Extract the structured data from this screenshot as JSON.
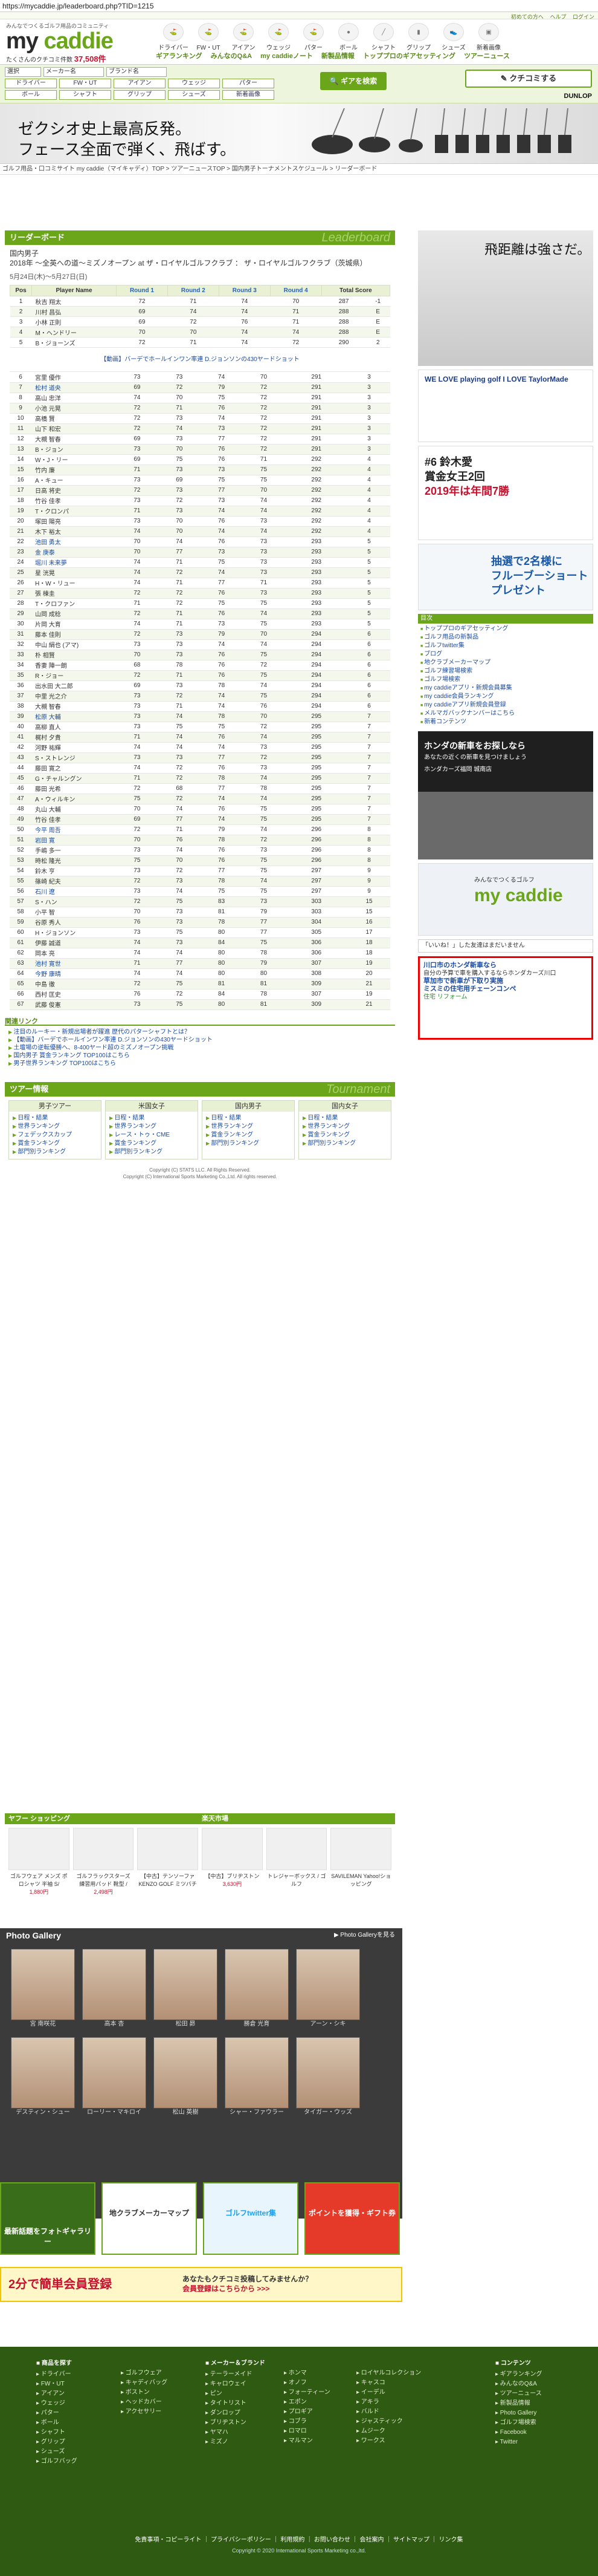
{
  "url": "https://mycaddie.jp/leaderboard.php?TID=1215",
  "top_links": [
    "初めての方へ",
    "ヘルプ",
    "ログイン"
  ],
  "logo": {
    "sub": "みんなでつくるゴルフ用品のコミュニティ",
    "name_a": "my ",
    "name_b": "caddie",
    "stat_label": "たくさんのクチコミ件数",
    "stat_value": "37,508件"
  },
  "category_nav": [
    "ドライバー",
    "FW・UT",
    "アイアン",
    "ウェッジ",
    "パター",
    "ボール",
    "シャフト",
    "グリップ",
    "シューズ",
    "新着画像"
  ],
  "sub_nav": [
    "ギアランキング",
    "みんなのQ&A",
    "my caddieノート",
    "新製品情報",
    "トッププロのギアセッティング",
    "ツアーニュース"
  ],
  "search": {
    "row1": [
      "選択",
      "メーカー名",
      "ブランド名"
    ],
    "row2": [
      "ドライバー",
      "FW・UT",
      "アイアン",
      "ウェッジ",
      "パター"
    ],
    "row3": [
      "ボール",
      "シャフト",
      "グリップ",
      "シューズ",
      "新着画像"
    ],
    "gear_btn": "ギアを検索",
    "kuchikomi_btn": "クチコミする",
    "dunlop": "DUNLOP"
  },
  "banner": {
    "line1": "ゼクシオ史上最高反発。",
    "line2": "フェース全面で弾く、飛ばす。"
  },
  "breadcrumb": "ゴルフ用品・口コミサイト my caddie（マイキャディ）TOP > ツアーニュースTOP > 国内男子トーナメントスケジュール > リーダーボード",
  "leaderboard": {
    "title": "リーダーボード",
    "title_en": "Leaderboard",
    "tour_line1": "国内男子",
    "tour_line2": "2018年 ～全英への道～ミズノオープン at ザ・ロイヤルゴルフクラブ ： ザ・ロイヤルゴルフクラブ（茨城県）",
    "date": "5月24日(木)～5月27日(日)",
    "headers": [
      "Pos",
      "Player Name",
      "Round 1",
      "Round 2",
      "Round 3",
      "Round 4",
      "Total Score"
    ],
    "note": "【動画】バーデでホールインワン率連 D.ジョンソンの430ヤードショット",
    "rows_a": [
      [
        "1",
        "秋吉 翔太",
        "72",
        "71",
        "74",
        "70",
        "287",
        "-1"
      ],
      [
        "2",
        "川村 昌弘",
        "69",
        "74",
        "74",
        "71",
        "288",
        "E"
      ],
      [
        "3",
        "小林 正則",
        "69",
        "72",
        "76",
        "71",
        "288",
        "E"
      ],
      [
        "4",
        "M・ヘンドリー",
        "70",
        "70",
        "74",
        "74",
        "288",
        "E"
      ],
      [
        "5",
        "B・ジョーンズ",
        "72",
        "71",
        "74",
        "72",
        "290",
        "2"
      ]
    ],
    "rows_b": [
      [
        "6",
        "宮里 優作",
        "73",
        "73",
        "74",
        "70",
        "291",
        "3"
      ],
      [
        "7",
        "松村 道央",
        "69",
        "72",
        "79",
        "72",
        "291",
        "3"
      ],
      [
        "8",
        "高山 忠洋",
        "74",
        "70",
        "75",
        "72",
        "291",
        "3"
      ],
      [
        "9",
        "小池 元晃",
        "72",
        "71",
        "76",
        "72",
        "291",
        "3"
      ],
      [
        "10",
        "高橋 賢",
        "72",
        "73",
        "74",
        "72",
        "291",
        "3"
      ],
      [
        "11",
        "山下 和宏",
        "72",
        "74",
        "73",
        "72",
        "291",
        "3"
      ],
      [
        "12",
        "大槻 智春",
        "69",
        "73",
        "77",
        "72",
        "291",
        "3"
      ],
      [
        "13",
        "B・ジョン",
        "73",
        "70",
        "76",
        "72",
        "291",
        "3"
      ],
      [
        "14",
        "W・J・リー",
        "69",
        "75",
        "76",
        "71",
        "292",
        "4"
      ],
      [
        "15",
        "竹内 廉",
        "71",
        "73",
        "73",
        "75",
        "292",
        "4"
      ],
      [
        "16",
        "A・キュー",
        "73",
        "69",
        "75",
        "75",
        "292",
        "4"
      ],
      [
        "17",
        "日高 将史",
        "72",
        "73",
        "77",
        "70",
        "292",
        "4"
      ],
      [
        "18",
        "竹谷 佳孝",
        "73",
        "72",
        "73",
        "74",
        "292",
        "4"
      ],
      [
        "19",
        "T・クロンパ",
        "71",
        "73",
        "74",
        "74",
        "292",
        "4"
      ],
      [
        "20",
        "塚田 陽亮",
        "73",
        "70",
        "76",
        "73",
        "292",
        "4"
      ],
      [
        "21",
        "木下 裕太",
        "74",
        "70",
        "74",
        "74",
        "292",
        "4"
      ],
      [
        "22",
        "池田 勇太",
        "70",
        "74",
        "76",
        "73",
        "293",
        "5"
      ],
      [
        "23",
        "金 庚泰",
        "70",
        "77",
        "73",
        "73",
        "293",
        "5"
      ],
      [
        "24",
        "堀川 未来夢",
        "74",
        "71",
        "75",
        "73",
        "293",
        "5"
      ],
      [
        "25",
        "星 洸晃",
        "74",
        "72",
        "74",
        "73",
        "293",
        "5"
      ],
      [
        "26",
        "H・W・リュー",
        "74",
        "71",
        "77",
        "71",
        "293",
        "5"
      ],
      [
        "27",
        "張 棟圭",
        "72",
        "72",
        "76",
        "73",
        "293",
        "5"
      ],
      [
        "28",
        "T・クロファン",
        "71",
        "72",
        "75",
        "75",
        "293",
        "5"
      ],
      [
        "29",
        "山岡 成稔",
        "72",
        "71",
        "76",
        "74",
        "293",
        "5"
      ],
      [
        "30",
        "片岡 大育",
        "74",
        "71",
        "73",
        "75",
        "293",
        "5"
      ],
      [
        "31",
        "藤本 佳則",
        "72",
        "73",
        "79",
        "70",
        "294",
        "6"
      ],
      [
        "32",
        "中山 絹也 (アマ)",
        "73",
        "73",
        "74",
        "74",
        "294",
        "6"
      ],
      [
        "33",
        "朴 相賢",
        "70",
        "73",
        "76",
        "75",
        "294",
        "6"
      ],
      [
        "34",
        "香妻 陣一朗",
        "68",
        "78",
        "76",
        "72",
        "294",
        "6"
      ],
      [
        "35",
        "R・ジョー",
        "72",
        "71",
        "76",
        "75",
        "294",
        "6"
      ],
      [
        "36",
        "出水田 大二郎",
        "69",
        "73",
        "78",
        "74",
        "294",
        "6"
      ],
      [
        "37",
        "中里 光之介",
        "73",
        "72",
        "74",
        "75",
        "294",
        "6"
      ],
      [
        "38",
        "大槻 智春",
        "73",
        "71",
        "74",
        "76",
        "294",
        "6"
      ],
      [
        "39",
        "松原 大輔",
        "73",
        "74",
        "78",
        "70",
        "295",
        "7"
      ],
      [
        "40",
        "高柳 直人",
        "73",
        "75",
        "75",
        "72",
        "295",
        "7"
      ],
      [
        "41",
        "梶村 夕貴",
        "71",
        "74",
        "76",
        "74",
        "295",
        "7"
      ],
      [
        "42",
        "河野 祐輝",
        "74",
        "74",
        "74",
        "73",
        "295",
        "7"
      ],
      [
        "43",
        "S・ストレンジ",
        "73",
        "73",
        "77",
        "72",
        "295",
        "7"
      ],
      [
        "44",
        "藤田 寛之",
        "74",
        "72",
        "76",
        "73",
        "295",
        "7"
      ],
      [
        "45",
        "G・チャルングン",
        "71",
        "72",
        "78",
        "74",
        "295",
        "7"
      ],
      [
        "46",
        "藤田 光希",
        "72",
        "68",
        "77",
        "78",
        "295",
        "7"
      ],
      [
        "47",
        "A・ウィルキン",
        "75",
        "72",
        "74",
        "74",
        "295",
        "7"
      ],
      [
        "48",
        "丸山 大輔",
        "70",
        "74",
        "76",
        "75",
        "295",
        "7"
      ],
      [
        "49",
        "竹谷 佳孝",
        "69",
        "77",
        "74",
        "75",
        "295",
        "7"
      ],
      [
        "50",
        "今平 周吾",
        "72",
        "71",
        "79",
        "74",
        "296",
        "8"
      ],
      [
        "51",
        "岩田 寛",
        "70",
        "76",
        "78",
        "72",
        "296",
        "8"
      ],
      [
        "52",
        "手嶋 多一",
        "73",
        "74",
        "76",
        "73",
        "296",
        "8"
      ],
      [
        "53",
        "時松 隆光",
        "75",
        "70",
        "76",
        "75",
        "296",
        "8"
      ],
      [
        "54",
        "鈴木 亨",
        "73",
        "72",
        "77",
        "75",
        "297",
        "9"
      ],
      [
        "55",
        "篠崎 紀夫",
        "72",
        "73",
        "78",
        "74",
        "297",
        "9"
      ],
      [
        "56",
        "石川 遼",
        "73",
        "74",
        "75",
        "75",
        "297",
        "9"
      ],
      [
        "57",
        "S・ハン",
        "72",
        "75",
        "83",
        "73",
        "303",
        "15"
      ],
      [
        "58",
        "小平 智",
        "70",
        "73",
        "81",
        "79",
        "303",
        "15"
      ],
      [
        "59",
        "谷原 秀人",
        "76",
        "73",
        "78",
        "77",
        "304",
        "16"
      ],
      [
        "60",
        "H・ジョンソン",
        "73",
        "75",
        "80",
        "77",
        "305",
        "17"
      ],
      [
        "61",
        "伊藤 誠道",
        "74",
        "73",
        "84",
        "75",
        "306",
        "18"
      ],
      [
        "62",
        "岡本 亮",
        "74",
        "74",
        "80",
        "78",
        "306",
        "18"
      ],
      [
        "63",
        "池村 寛世",
        "71",
        "77",
        "80",
        "79",
        "307",
        "19"
      ],
      [
        "64",
        "今野 康晴",
        "74",
        "74",
        "80",
        "80",
        "308",
        "20"
      ],
      [
        "65",
        "中島 徹",
        "72",
        "75",
        "81",
        "81",
        "309",
        "21"
      ],
      [
        "66",
        "西村 匡史",
        "76",
        "72",
        "84",
        "78",
        "307",
        "19"
      ],
      [
        "67",
        "武藤 俊憲",
        "73",
        "75",
        "80",
        "81",
        "309",
        "21"
      ]
    ]
  },
  "related": {
    "title": "関連リンク",
    "items": [
      "注目のルーキー・新規出場者が躍進 歴代のパターシャフトとは？",
      "【動画】バーデでホールインワン率連 D.ジョンソンの430ヤードショット",
      "土壇場の逆転優勝へ、8-400ヤード超のミズノオープン挑戦",
      "国内男子 賞金ランキング TOP100はこちら",
      "男子世界ランキング TOP100はこちら"
    ]
  },
  "tour_info": {
    "title": "ツアー情報",
    "title_en": "Tournament",
    "cols": [
      {
        "h": "男子ツアー",
        "items": [
          "日程・結果",
          "世界ランキング",
          "フェデックスカップ",
          "賞金ランキング",
          "部門別ランキング"
        ]
      },
      {
        "h": "米国女子",
        "items": [
          "日程・結果",
          "世界ランキング",
          "レース・トゥ・CME",
          "賞金ランキング",
          "部門別ランキング"
        ]
      },
      {
        "h": "国内男子",
        "items": [
          "日程・結果",
          "世界ランキング",
          "賞金ランキング",
          "部門別ランキング"
        ]
      },
      {
        "h": "国内女子",
        "items": [
          "日程・結果",
          "世界ランキング",
          "賞金ランキング",
          "部門別ランキング"
        ]
      }
    ],
    "copy1": "Copyright (C) STATS LLC. All Rights Reserved.",
    "copy2": "Copyright (C) International Sports Marketing Co.,Ltd. All rights reserved."
  },
  "shopping": {
    "a": "ヤフー ショッピング",
    "b": "楽天市場",
    "items": [
      {
        "n": "ゴルフウェア メンズ ポロシャツ 半袖 S/",
        "p": "1,880円"
      },
      {
        "n": "ゴルフラックスターズ 練習用パッド 靴型 /",
        "p": "2,498円"
      },
      {
        "n": "【中古】テンソーファ KENZO GOLF ミツバチ",
        "p": ""
      },
      {
        "n": "【中古】ブリヂストン",
        "p": "3,630円"
      },
      {
        "n": "トレジャーボックス / ゴルフ",
        "p": ""
      },
      {
        "n": "SAVILEMAN Yahoo!ショッピング",
        "p": ""
      }
    ]
  },
  "gallery": {
    "title": "Photo Gallery",
    "more": "▶ Photo Galleryを見る",
    "names": [
      "宮 南咲花",
      "高本 杏",
      "松田 昴",
      "勝倉 光育",
      "アーン・シキ",
      "デスティン・シュー",
      "ローリー・マキロイ",
      "松山 英樹",
      "シャー・ファウラー",
      "タイガー・ウッズ"
    ]
  },
  "promos": [
    "最新話題をフォトギャラリー",
    "地クラブメーカーマップ",
    "ゴルフtwitter集",
    "ポイントを獲得・ギフト券"
  ],
  "register": {
    "a": "2分で簡単会員登録",
    "b1": "あなたもクチコミ投稿してみませんか？",
    "b2": "会員登録はこちらから >>>"
  },
  "side": {
    "ad1": "飛距離は強さだ。",
    "ad2": "WE LOVE playing golf I LOVE TaylorMade",
    "ad3_1": "#6 鈴木愛",
    "ad3_2": "賞金女王2回",
    "ad3_3": "2019年は年間7勝",
    "ad4_1": "抽選で2名様に",
    "ad4_2": "フルーブーショート",
    "ad4_3": "プレゼント",
    "list_title": "目次",
    "list": [
      "トッププロのギアセッティング",
      "ゴルフ用品の新製品",
      "ゴルフtwitter集",
      "ブログ",
      "地クラブメーカーマップ",
      "ゴルフ練習場検索",
      "ゴルフ場検索",
      "my caddieアプリ・新規会員募集",
      "my caddie会員ランキング",
      "my caddieアプリ新規会員登録",
      "メルマガバックナンバーはこちら",
      "新着コンテンツ"
    ],
    "honda": "ホンダの新車をお探しなら",
    "honda2": "あなたの近くの新車を見つけましょう",
    "honda3": "ホンダカーズ福岡 城南店",
    "mc_sub": "みんなでつくるゴルフ",
    "fb": "「いいね！」した友達はまだいません",
    "textad": [
      "川口市のホンダ新車なら",
      "自分の予算で車を購入するならホンダカーズ川口",
      "草加市で新車が下取り実施",
      "ミスミの住宅用チェーンコンペ",
      "住宅 リフォーム"
    ]
  },
  "footer": {
    "cols": [
      {
        "h": "■ 商品を探す",
        "items": [
          "ドライバー",
          "FW・UT",
          "アイアン",
          "ウェッジ",
          "パター",
          "ボール",
          "シャフト",
          "グリップ",
          "シューズ",
          "ゴルフバッグ"
        ]
      },
      {
        "h": "",
        "items": [
          "ゴルフウェア",
          "キャディバッグ",
          "ボストン",
          "ヘッドカバー",
          "アクセサリー"
        ]
      },
      {
        "h": "■ メーカー＆ブランド",
        "items": [
          "テーラーメイド",
          "キャロウェイ",
          "ピン",
          "タイトリスト",
          "ダンロップ",
          "ブリヂストン",
          "ヤマハ",
          "ミズノ"
        ]
      },
      {
        "h": "",
        "items": [
          "ホンマ",
          "オノフ",
          "フォーティーン",
          "エポン",
          "プロギア",
          "コブラ",
          "ロマロ",
          "マルマン"
        ]
      },
      {
        "h": "",
        "items": [
          "ロイヤルコレクション",
          "キャスコ",
          "イーデル",
          "アキラ",
          "バルド",
          "ジャスティック",
          "ムジーク",
          "ワークス"
        ]
      },
      {
        "h": "■ コンテンツ",
        "items": [
          "ギアランキング",
          "みんなのQ&A",
          "ツアーニュース",
          "新製品情報",
          "Photo Gallery",
          "ゴルフ場検索",
          "Facebook",
          "Twitter"
        ]
      }
    ],
    "links": "免責事項・コピーライト ｜ プライバシーポリシー ｜ 利用規約 ｜ お問い合わせ ｜ 会社案内 ｜ サイトマップ ｜ リンク集",
    "copy": "Copyright © 2020 International Sports Marketing co.,ltd."
  }
}
